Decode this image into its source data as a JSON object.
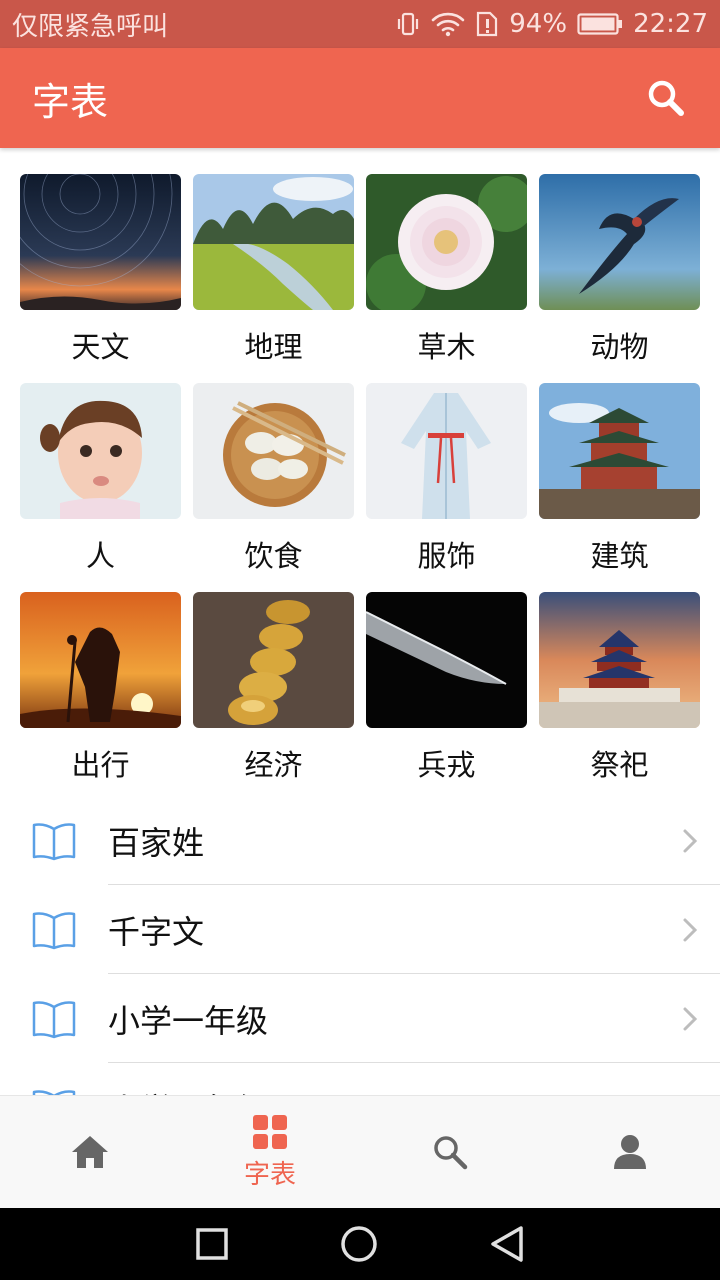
{
  "status_bar": {
    "carrier": "仅限紧急呼叫",
    "battery": "94%",
    "time": "22:27"
  },
  "app_bar": {
    "title": "字表",
    "search_icon": "search-icon"
  },
  "categories": [
    {
      "label": "天文",
      "image": "star-trails-photo"
    },
    {
      "label": "地理",
      "image": "karst-river-landscape-photo"
    },
    {
      "label": "草木",
      "image": "dahlia-flower-photo"
    },
    {
      "label": "动物",
      "image": "swallow-bird-photo"
    },
    {
      "label": "人",
      "image": "child-portrait-photo"
    },
    {
      "label": "饮食",
      "image": "dumplings-bowl-photo"
    },
    {
      "label": "服饰",
      "image": "hanfu-robe-photo"
    },
    {
      "label": "建筑",
      "image": "chinese-tower-photo"
    },
    {
      "label": "出行",
      "image": "traveler-sunset-photo"
    },
    {
      "label": "经济",
      "image": "gold-coins-photo"
    },
    {
      "label": "兵戎",
      "image": "sword-blade-photo"
    },
    {
      "label": "祭祀",
      "image": "temple-of-heaven-photo"
    }
  ],
  "list": [
    {
      "label": "百家姓"
    },
    {
      "label": "千字文"
    },
    {
      "label": "小学一年级"
    },
    {
      "label": "小学二年级"
    }
  ],
  "bottom_nav": {
    "active_label": "字表",
    "items": [
      "home-icon",
      "grid-icon",
      "search-icon",
      "user-icon"
    ]
  },
  "colors": {
    "accent": "#ef6550",
    "status_bar": "#c9574a",
    "book_icon": "#5aa0e6"
  }
}
